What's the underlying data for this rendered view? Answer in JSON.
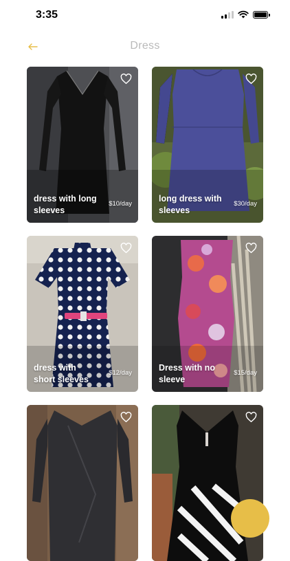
{
  "status_bar": {
    "time": "3:35"
  },
  "nav": {
    "title": "Dress",
    "back_icon": "back-arrow-icon",
    "accent": "#e7be48"
  },
  "cards": [
    {
      "name": "dress with long sleeves",
      "price": "$10/day"
    },
    {
      "name": "long dress with sleeves",
      "price": "$30/day"
    },
    {
      "name": "dress with short sleeves",
      "price": "$12/day"
    },
    {
      "name": "Dress with no sleeve",
      "price": "$15/day"
    },
    {
      "name": "",
      "price": ""
    },
    {
      "name": "",
      "price": ""
    }
  ],
  "icons": {
    "favorite": "heart-outline-icon",
    "floating_action": "fab-button"
  }
}
